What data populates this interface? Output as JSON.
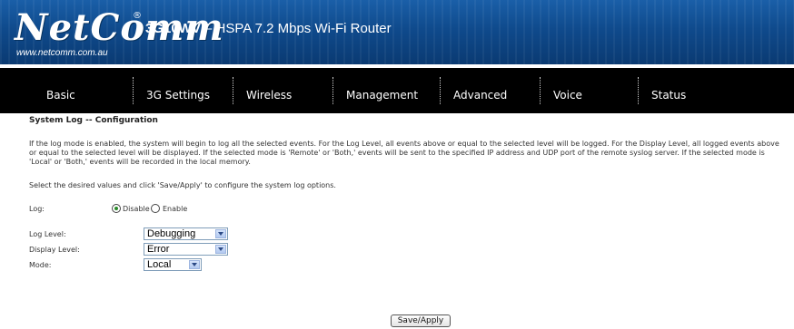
{
  "header": {
    "logo_text": "NetComm",
    "logo_mark": "®",
    "logo_url": "www.netcomm.com.au",
    "product_model": "3G10WV",
    "product_desc": " – HSPA 7.2 Mbps Wi-Fi Router"
  },
  "nav": {
    "items": [
      {
        "label": "Basic"
      },
      {
        "label": "3G Settings"
      },
      {
        "label": "Wireless"
      },
      {
        "label": "Management"
      },
      {
        "label": "Advanced"
      },
      {
        "label": "Voice"
      },
      {
        "label": "Status"
      }
    ]
  },
  "page": {
    "title": "System Log -- Configuration",
    "description": "If the log mode is enabled, the system will begin to log all the selected events. For the Log Level, all events above or equal to the selected level will be logged. For the Display Level, all logged events above or equal to the selected level will be displayed. If the selected mode is 'Remote' or 'Both,' events will be sent to the specified IP address and UDP port of the remote syslog server. If the selected mode is 'Local' or 'Both,' events will be recorded in the local memory.",
    "instruction": "Select the desired values and click 'Save/Apply' to configure the system log options."
  },
  "form": {
    "log_label": "Log:",
    "log_disable_label": "Disable",
    "log_enable_label": "Enable",
    "log_selected": "Disable",
    "log_level_label": "Log Level:",
    "log_level_value": "Debugging",
    "display_level_label": "Display Level:",
    "display_level_value": "Error",
    "mode_label": "Mode:",
    "mode_value": "Local",
    "save_button": "Save/Apply"
  },
  "colors": {
    "header_blue": "#0f4a8c",
    "nav_black": "#000000",
    "radio_checked": "#2a8a2a"
  }
}
